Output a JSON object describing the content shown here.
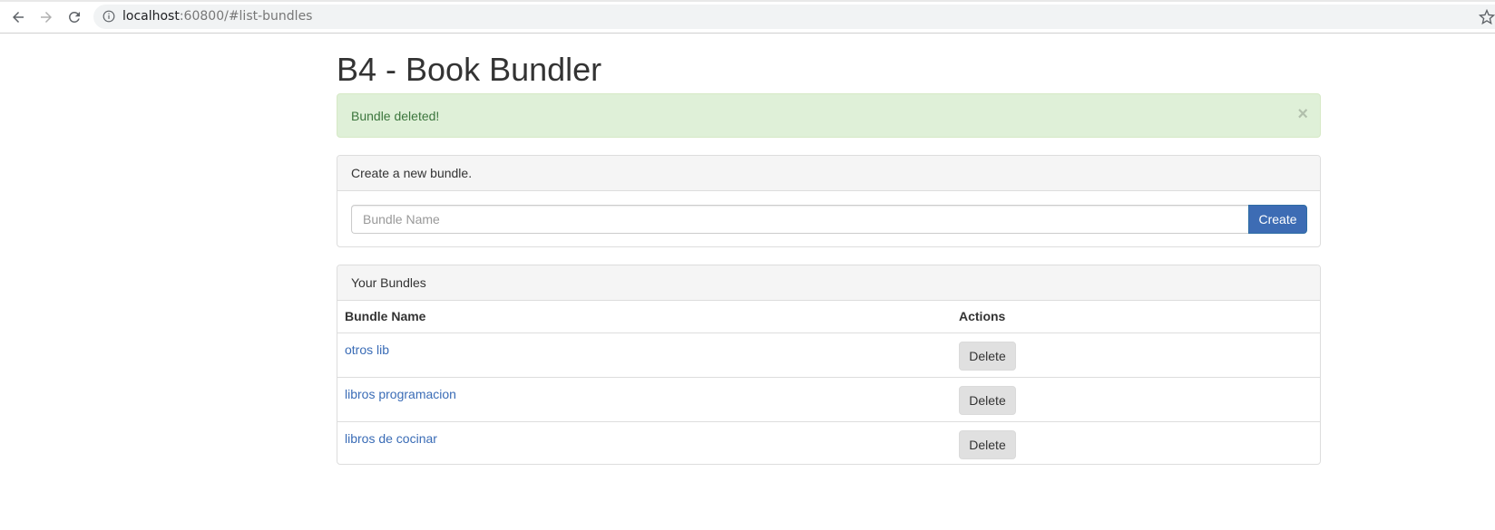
{
  "browser": {
    "url_host": "localhost",
    "url_rest": ":60800/#list-bundles",
    "icons": {
      "back": "arrow-left-icon",
      "forward": "arrow-right-icon",
      "reload": "reload-icon",
      "info": "info-icon",
      "bookmark": "star-icon"
    }
  },
  "page": {
    "title": "B4 - Book Bundler"
  },
  "alert": {
    "message": "Bundle deleted!",
    "close_glyph": "×",
    "color": "#3c763d",
    "background": "#dff0d8"
  },
  "create_panel": {
    "heading": "Create a new bundle.",
    "input_placeholder": "Bundle Name",
    "input_value": "",
    "button_label": "Create",
    "button_color": "#3d6cb4"
  },
  "bundles_panel": {
    "heading": "Your Bundles",
    "columns": [
      "Bundle Name",
      "Actions"
    ],
    "rows": [
      {
        "name": "otros lib",
        "action": "Delete"
      },
      {
        "name": "libros programacion",
        "action": "Delete"
      },
      {
        "name": "libros de cocinar",
        "action": "Delete"
      }
    ],
    "link_color": "#3a6cb6"
  }
}
